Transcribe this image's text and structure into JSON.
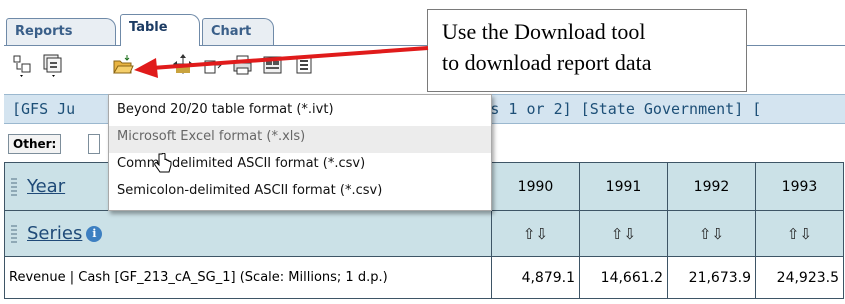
{
  "tabs": [
    {
      "label": "Reports",
      "active": false
    },
    {
      "label": "Table",
      "active": true
    },
    {
      "label": "Chart",
      "active": false
    }
  ],
  "toolbar_icons": [
    "pivot-icon",
    "layout-icon",
    "download-folder-icon",
    "move-icon",
    "export-icon",
    "print-icon",
    "print-preview-icon",
    "notes-icon"
  ],
  "header_strip": {
    "left": "[GFS Ju",
    "right": "bles 1 or 2] [State Government] ["
  },
  "other": {
    "label": "Other:"
  },
  "menu": {
    "items": [
      "Beyond 20/20 table format (*.ivt)",
      "Microsoft Excel format (*.xls)",
      "Comma-delimited ASCII format (*.csv)",
      "Semicolon-delimited ASCII format (*.csv)"
    ],
    "hover_index": 1
  },
  "callout": {
    "line1": "Use the Download tool",
    "line2": "to download report data"
  },
  "table": {
    "year_label": "Year",
    "series_label": "Series",
    "info_icon": "i",
    "years": [
      "1990",
      "1991",
      "1992",
      "1993"
    ],
    "sort_arrows": "⇧⇩",
    "row_label": "Revenue | Cash [GF_213_cA_SG_1] (Scale: Millions; 1 d.p.)",
    "values": [
      "4,879.1",
      "14,661.2",
      "21,673.9",
      "24,923.5"
    ]
  },
  "colors": {
    "accent_arrow": "#e01b1b",
    "header_bg": "#cbe1e7",
    "strip_bg": "#d4e4f0"
  }
}
